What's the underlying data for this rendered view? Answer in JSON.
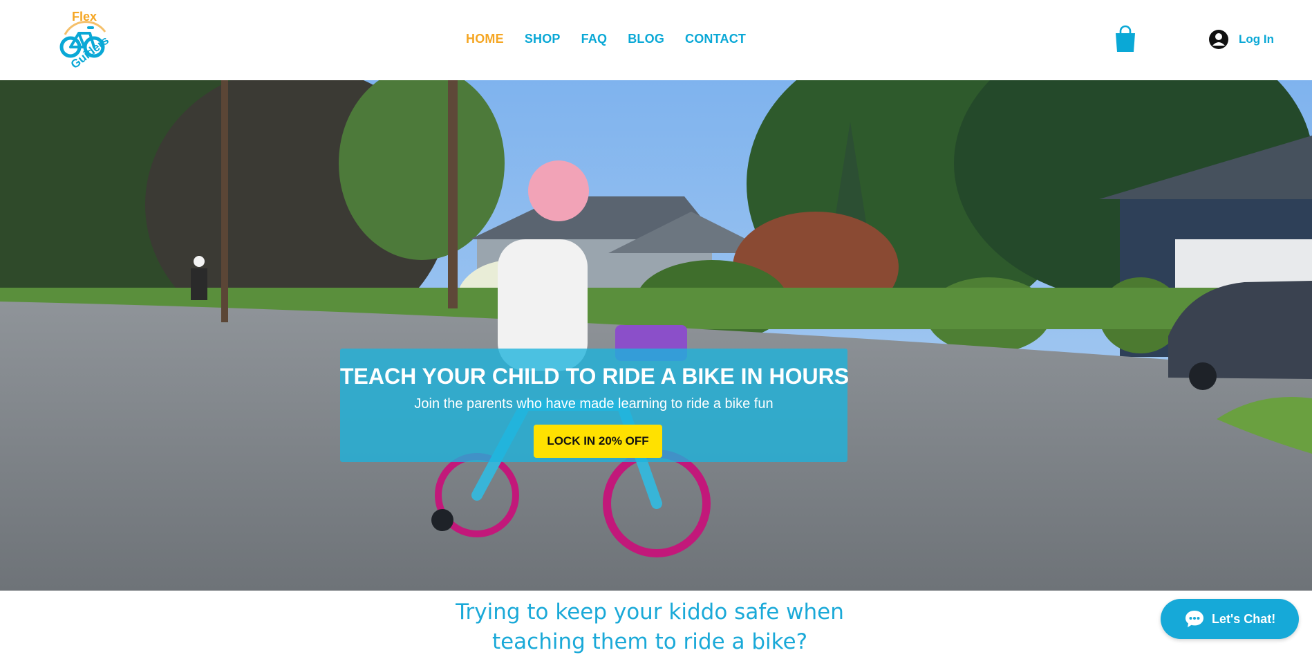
{
  "brand": {
    "logo_word_top": "Flex",
    "logo_word_bottom": "Guiders",
    "primary_color": "#0aa8d6",
    "accent_color": "#f5a623"
  },
  "nav": {
    "items": [
      {
        "label": "HOME",
        "active": true
      },
      {
        "label": "SHOP",
        "active": false
      },
      {
        "label": "FAQ",
        "active": false
      },
      {
        "label": "BLOG",
        "active": false
      },
      {
        "label": "CONTACT",
        "active": false
      }
    ]
  },
  "header": {
    "cart_icon": "shopping-bag-icon",
    "login_icon": "user-avatar-icon",
    "login_label": "Log In"
  },
  "hero": {
    "title": "TEACH YOUR CHILD TO RIDE A BIKE IN HOURS",
    "subtitle": "Join the parents who have made learning to ride a bike fun",
    "cta_label": "LOCK IN 20% OFF",
    "cta_color": "#ffe100",
    "overlay_color": "#1cb4dc"
  },
  "intro": {
    "heading_line1": "Trying to keep your kiddo safe when",
    "heading_line2": "teaching them to ride a bike?"
  },
  "chat": {
    "icon": "chat-bubble-icon",
    "label": "Let's Chat!"
  }
}
